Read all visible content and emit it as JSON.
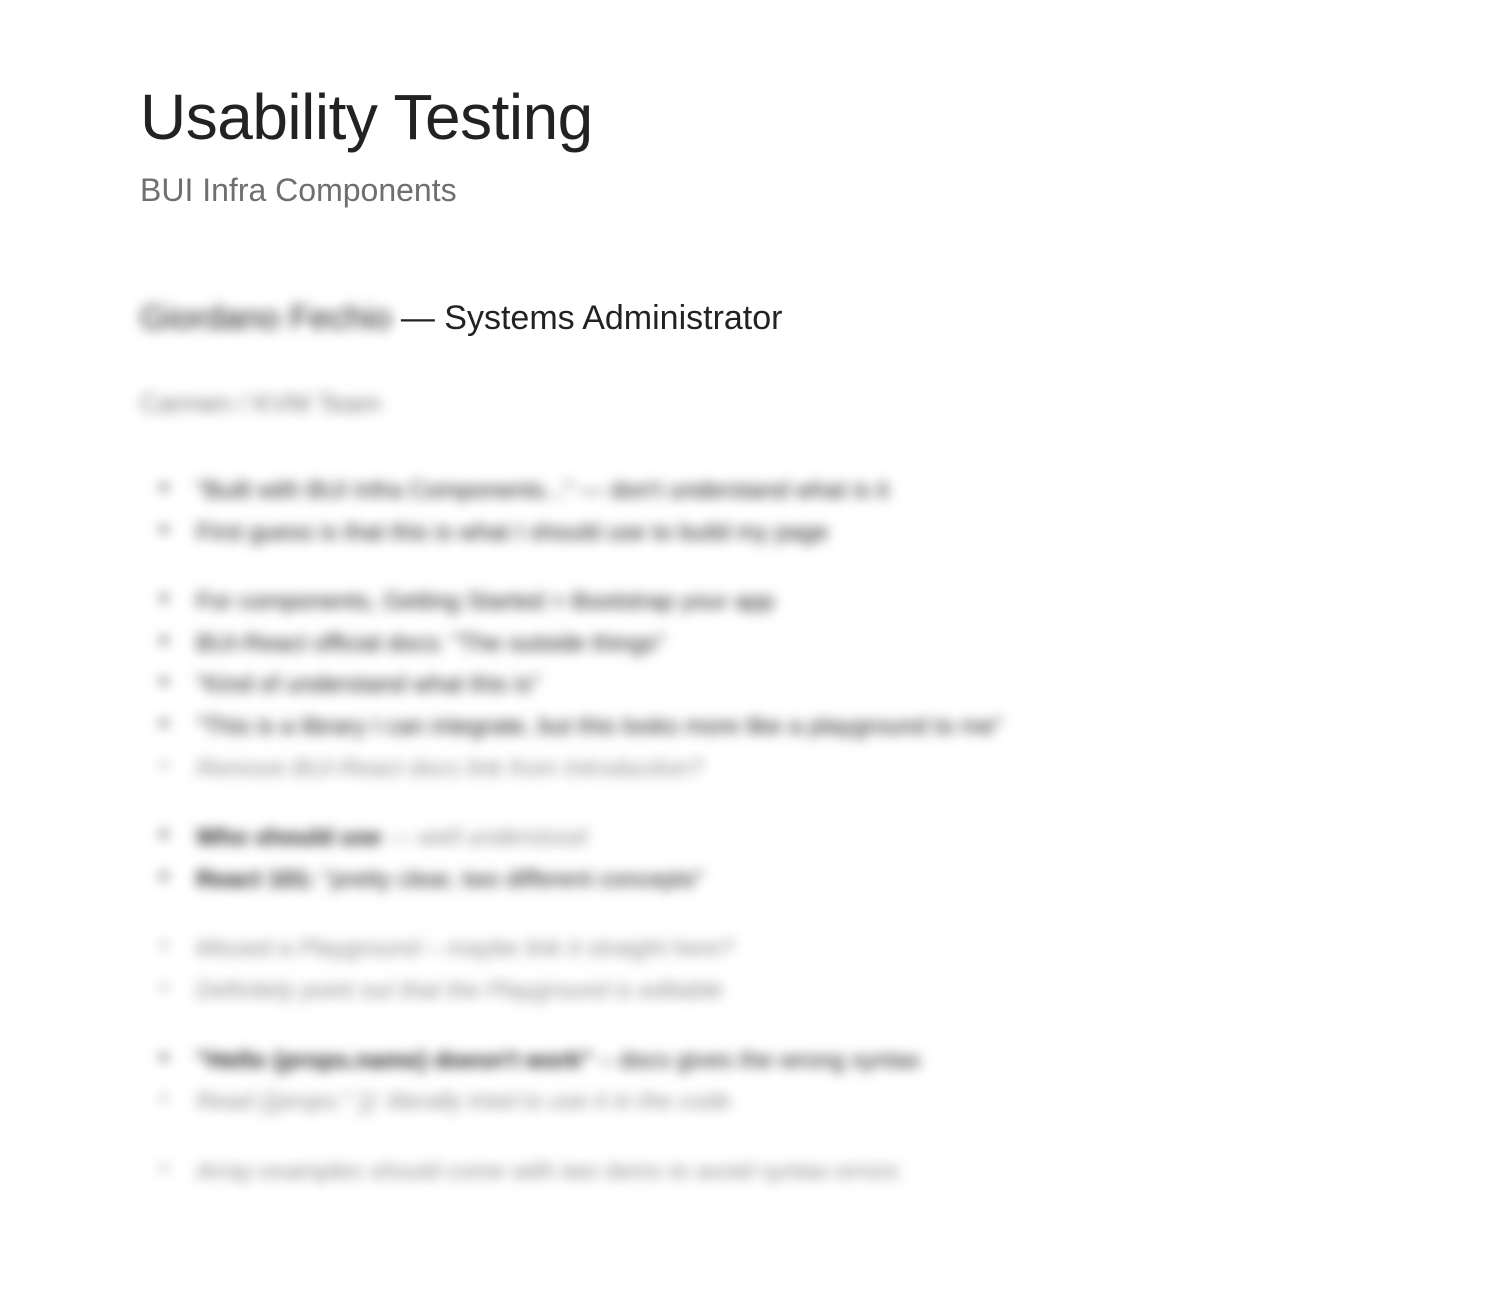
{
  "title": "Usability Testing",
  "subtitle": "BUI Infra Components",
  "participant": {
    "name": "Giordano Fechio",
    "role": "Systems Administrator",
    "team": "Carmen / KVM Team"
  },
  "notes_groups": [
    [
      {
        "text": "\"Built with BUI Infra Components...\" — don't understand what is it",
        "muted": false
      },
      {
        "text": "First guess is that this is what I should use to build my page",
        "muted": false
      }
    ],
    [
      {
        "text": "For components, Getting Started > Bootstrap your app",
        "muted": false
      },
      {
        "text": "BUI-React official docs: \"The outside things\"",
        "muted": false
      },
      {
        "text": "\"Kind of understand what this is\"",
        "muted": false
      },
      {
        "text": "\"This is a library I can integrate, but this looks more like a playground to me\"",
        "muted": false
      },
      {
        "text": "Remove BUI-React docs link from Introduction?",
        "muted": true,
        "italic": true,
        "lightBullet": true
      }
    ],
    [
      {
        "prefix_bold": "Who should use",
        "suffix_muted": " — well understood",
        "muted": false
      },
      {
        "prefix_bold": "React 101:",
        "suffix": " \"pretty clear, two different concepts\"",
        "muted": false
      }
    ],
    [
      {
        "text": "Missed a Playground – maybe link it straight here?",
        "muted": true,
        "italic": true,
        "lightBullet": true
      },
      {
        "text": "Definitely point out that the Playground is editable",
        "muted": true,
        "italic": true,
        "lightBullet": true
      }
    ],
    [
      {
        "prefix_bold": "\"Hello {props.name} doesn't work\"",
        "suffix": " – docs gives the wrong syntax",
        "muted": false
      },
      {
        "text": "Read {{props:'' }}: literally tried to use it in the code",
        "muted": true,
        "italic": true,
        "lightBullet": true
      }
    ],
    [
      {
        "text": "Array examples should come with two items to avoid syntax errors",
        "muted": true,
        "italic": true,
        "lightBullet": true
      }
    ]
  ]
}
